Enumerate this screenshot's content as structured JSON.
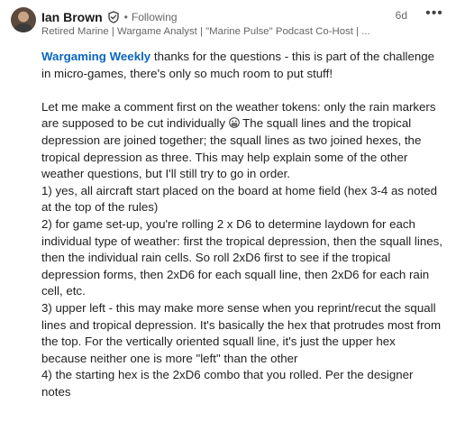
{
  "author": {
    "name": "Ian Brown",
    "dot": "•",
    "follow_status": "Following",
    "headline": "Retired Marine | Wargame Analyst | \"Marine Pulse\" Podcast Co-Host | ..."
  },
  "meta": {
    "timestamp": "6d",
    "more_label": "•••"
  },
  "comment": {
    "mention": "Wargaming Weekly",
    "intro": " thanks for the questions - this is part of the challenge in micro-games, there's only so much room to put stuff!",
    "weather_before_emoji": "Let me make a comment first on the weather tokens: only the rain markers are supposed to be cut individually ",
    "emoji": "grimacing-face-emoji",
    "weather_after_emoji": " The squall lines and the tropical depression are joined together; the squall lines as two joined hexes, the tropical depression as three. This may help explain some of the other weather questions, but I'll still try to go in order.",
    "answer1": "1) yes, all aircraft start placed on the board at home field (hex 3-4 as noted at the top of the rules)",
    "answer2": "2) for game set-up, you're rolling 2 x D6 to determine laydown for each individual type of weather: first the tropical depression, then the squall lines, then the individual rain cells. So roll 2xD6 first to see if the tropical depression forms, then 2xD6 for each squall line, then 2xD6 for each rain cell, etc.",
    "answer3": "3) upper left - this may make more sense when you reprint/recut the squall lines and tropical depression. It's basically the hex that protrudes most from the top. For the vertically oriented squall line, it's just the upper hex because neither one is more \"left\" than the other",
    "answer4": "4) the starting hex is the 2xD6 combo that you rolled. Per the designer notes"
  },
  "colors": {
    "link": "#0a66c2",
    "secondary_text": "#666666",
    "body_text": "#1f1f1f"
  },
  "icons": {
    "verified": "verified-badge-icon",
    "more": "more-horizontal-icon"
  }
}
